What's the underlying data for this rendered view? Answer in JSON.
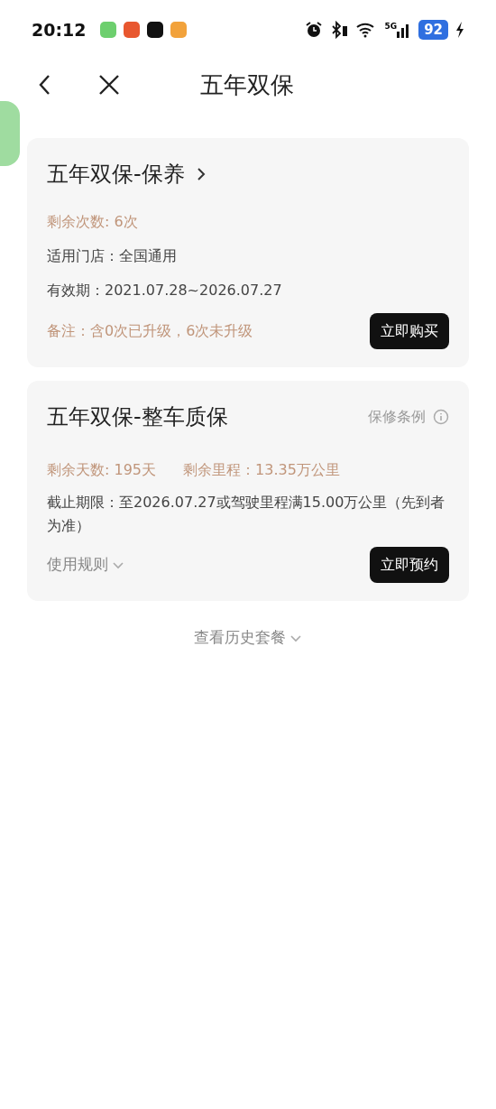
{
  "status_bar": {
    "time": "20:12",
    "network": "5G",
    "battery": "92"
  },
  "nav": {
    "title": "五年双保"
  },
  "cards": [
    {
      "title": "五年双保-保养",
      "chevron": true,
      "lines": [
        {
          "kind": "accent",
          "texts": [
            "剩余次数: 6次"
          ]
        },
        {
          "kind": "plain",
          "texts": [
            "适用门店：全国通用"
          ]
        },
        {
          "kind": "plain",
          "texts": [
            "有效期：2021.07.28~2026.07.27"
          ]
        },
        {
          "kind": "accent",
          "texts": [
            "备注：含0次已升级，6次未升级"
          ]
        }
      ],
      "button": "立即购买"
    },
    {
      "title": "五年双保-整车质保",
      "chevron": false,
      "link": "保修条例",
      "lines": [
        {
          "kind": "accent",
          "texts": [
            "剩余天数: 195天",
            "剩余里程：13.35万公里"
          ]
        },
        {
          "kind": "plain",
          "texts": [
            "截止期限：至2026.07.27或驾驶里程满15.00万公里（先到者为准）"
          ]
        }
      ],
      "toggle": "使用规则",
      "button": "立即预约"
    }
  ],
  "history_link": "查看历史套餐"
}
